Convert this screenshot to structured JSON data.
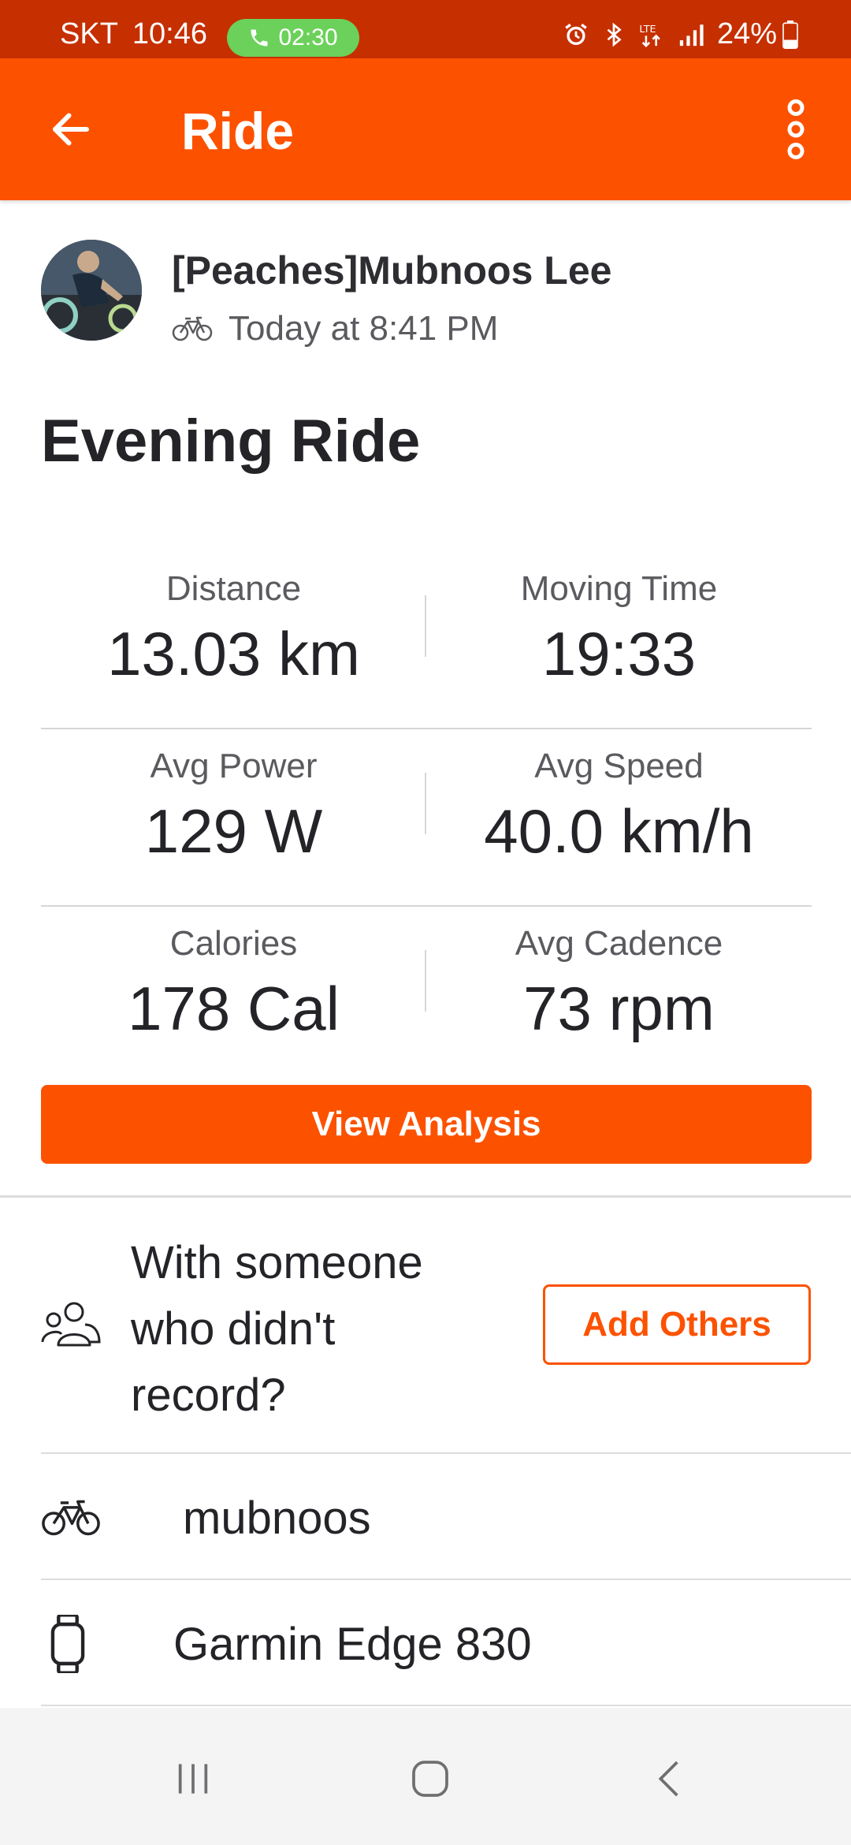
{
  "status_bar": {
    "carrier": "SKT",
    "time": "10:46",
    "call_timer": "02:30",
    "battery": "24%",
    "icons": [
      "alarm-icon",
      "bluetooth-icon",
      "lte-icon",
      "signal-icon",
      "battery-icon"
    ]
  },
  "appbar": {
    "title": "Ride",
    "back_icon": "arrow-left-icon",
    "more_icon": "more-vertical-icon"
  },
  "athlete": {
    "name": "[Peaches]Mubnoos Lee",
    "activity_icon": "bike-icon",
    "time": "Today at 8:41 PM"
  },
  "activity": {
    "title": "Evening Ride"
  },
  "stats": [
    {
      "label": "Distance",
      "value": "13.03 km"
    },
    {
      "label": "Moving Time",
      "value": "19:33"
    },
    {
      "label": "Avg Power",
      "value": "129 W"
    },
    {
      "label": "Avg Speed",
      "value": "40.0 km/h"
    },
    {
      "label": "Calories",
      "value": "178 Cal"
    },
    {
      "label": "Avg Cadence",
      "value": "73 rpm"
    }
  ],
  "view_analysis_label": "View Analysis",
  "with_others": {
    "text": "With someone who didn't record?",
    "button_label": "Add Others"
  },
  "gear": {
    "bike_name": "mubnoos",
    "device_name": "Garmin Edge 830"
  },
  "colors": {
    "brand": "#fc5200",
    "status_bar": "#c62f00",
    "call_pill": "#6bd15a"
  }
}
